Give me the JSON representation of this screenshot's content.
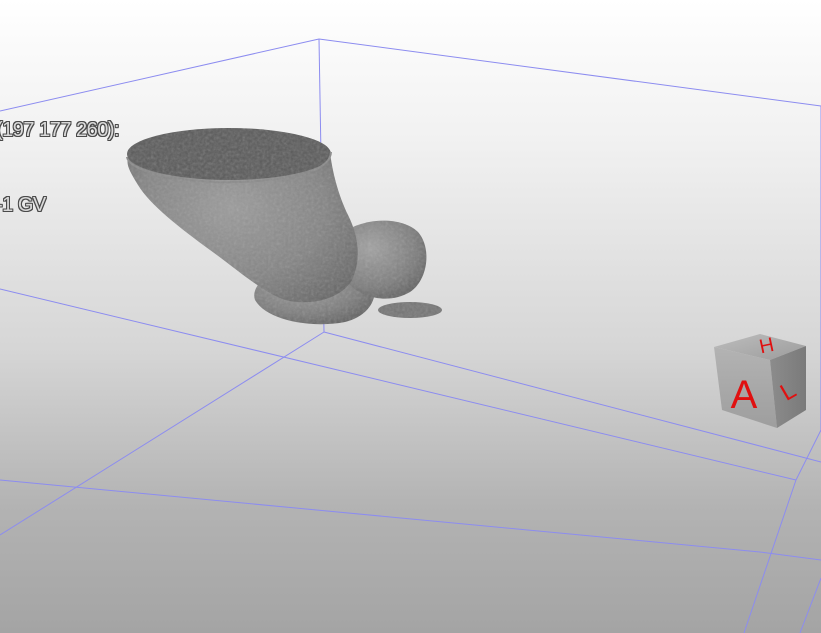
{
  "readout": {
    "position_line": "(197 177 260):",
    "value_line": "-1 GV"
  },
  "orientation_cube": {
    "front_label": "A",
    "top_label": "H",
    "side_label": "L",
    "label_color": "#e01010",
    "face_color": "#9a9a9a"
  },
  "bounding_box": {
    "line_color": "#8c8cf0"
  },
  "volume": {
    "surface_color": "#7a7a7a"
  }
}
